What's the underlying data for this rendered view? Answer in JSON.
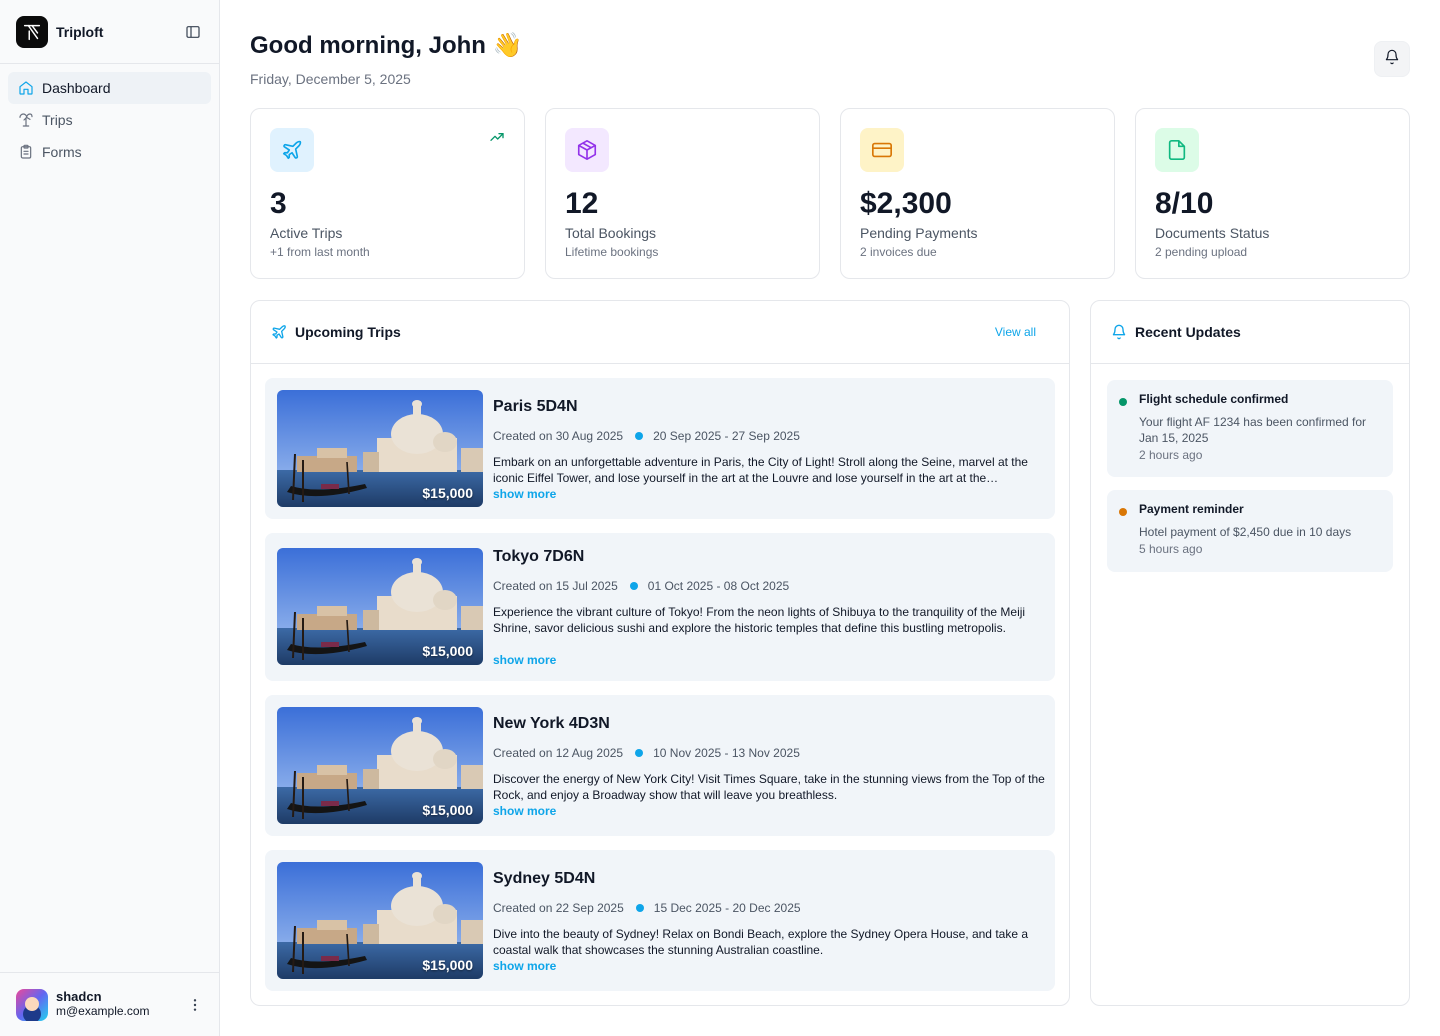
{
  "sidebar": {
    "brand_name": "Triploft",
    "nav": [
      {
        "label": "Dashboard",
        "icon": "home-icon",
        "active": true
      },
      {
        "label": "Trips",
        "icon": "palm-tree-icon",
        "active": false
      },
      {
        "label": "Forms",
        "icon": "clipboard-icon",
        "active": false
      }
    ],
    "user": {
      "name": "shadcn",
      "email": "m@example.com"
    }
  },
  "header": {
    "greeting": "Good morning, John 👋",
    "date": "Friday, December 5, 2025"
  },
  "stats": [
    {
      "value": "3",
      "label": "Active Trips",
      "sub": "+1 from last month",
      "icon": "plane-icon",
      "color": "#0ea5e9",
      "bg": "#e0f2fe",
      "trend": true
    },
    {
      "value": "12",
      "label": "Total Bookings",
      "sub": "Lifetime bookings",
      "icon": "package-icon",
      "color": "#9333ea",
      "bg": "#f3e8ff"
    },
    {
      "value": "$2,300",
      "label": "Pending Payments",
      "sub": "2 invoices due",
      "icon": "credit-card-icon",
      "color": "#d97706",
      "bg": "#fef3c7"
    },
    {
      "value": "8/10",
      "label": "Documents Status",
      "sub": "2 pending upload",
      "icon": "file-icon",
      "color": "#10b981",
      "bg": "#dcfce7"
    }
  ],
  "upcoming": {
    "title": "Upcoming Trips",
    "view_all": "View all",
    "show_more": "show more",
    "trips": [
      {
        "title": "Paris 5D4N",
        "created": "Created on 30 Aug 2025",
        "dates": "20 Sep 2025 - 27 Sep 2025",
        "price": "$15,000",
        "description": "Embark on an unforgettable adventure in Paris, the City of Light! Stroll along the Seine, marvel at the iconic Eiffel Tower, and lose yourself in the art at the Louvre and lose yourself in the art at the…"
      },
      {
        "title": "Tokyo 7D6N",
        "created": "Created on 15 Jul 2025",
        "dates": "01 Oct 2025 - 08 Oct 2025",
        "price": "$15,000",
        "description": "Experience the vibrant culture of Tokyo! From the neon lights of Shibuya to the tranquility of the Meiji Shrine, savor delicious sushi and explore the historic temples that define this bustling metropolis."
      },
      {
        "title": "New York 4D3N",
        "created": "Created on 12 Aug 2025",
        "dates": "10 Nov 2025 - 13 Nov 2025",
        "price": "$15,000",
        "description": "Discover the energy of New York City! Visit Times Square, take in the stunning views from the Top of the Rock, and enjoy a Broadway show that will leave you breathless."
      },
      {
        "title": "Sydney 5D4N",
        "created": "Created on 22 Sep 2025",
        "dates": "15 Dec 2025 - 20 Dec 2025",
        "price": "$15,000",
        "description": "Dive into the beauty of Sydney! Relax on Bondi Beach, explore the Sydney Opera House, and take a coastal walk that showcases the stunning Australian coastline."
      }
    ]
  },
  "updates": {
    "title": "Recent Updates",
    "items": [
      {
        "title": "Flight schedule confirmed",
        "text": "Your flight AF 1234 has been confirmed for Jan 15, 2025",
        "time": "2 hours ago",
        "color": "#059669"
      },
      {
        "title": "Payment reminder",
        "text": "Hotel payment of $2,450 due in 10 days",
        "time": "5 hours ago",
        "color": "#d97706"
      }
    ]
  }
}
